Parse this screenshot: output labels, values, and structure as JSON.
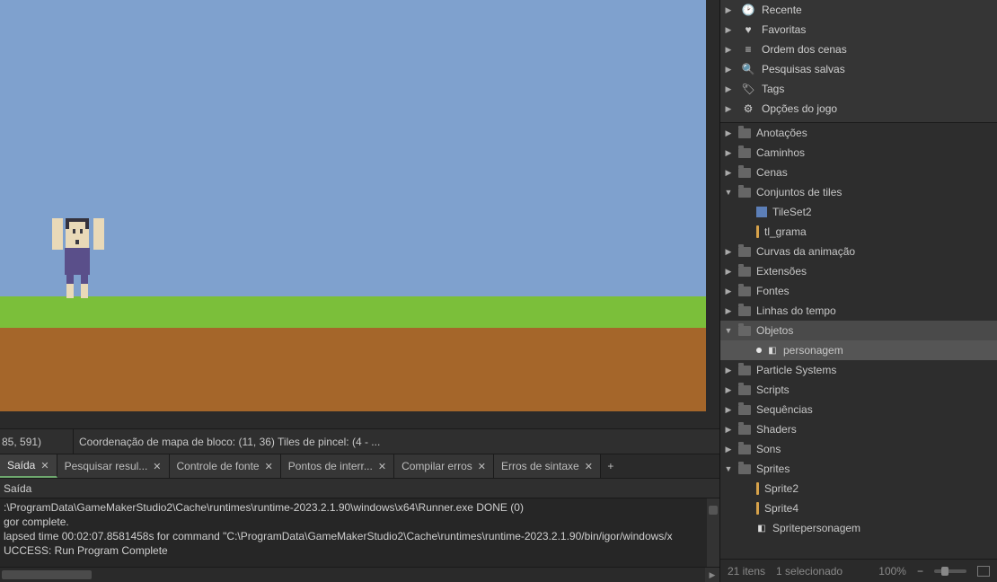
{
  "status": {
    "coords": "85, 591)",
    "info": "Coordenação de mapa de bloco: (11, 36) Tiles de pincel: (4 - ..."
  },
  "output_tabs": [
    {
      "label": "Saída",
      "active": true
    },
    {
      "label": "Pesquisar resul...",
      "active": false
    },
    {
      "label": "Controle de fonte",
      "active": false
    },
    {
      "label": "Pontos de interr...",
      "active": false
    },
    {
      "label": "Compilar erros",
      "active": false
    },
    {
      "label": "Erros de sintaxe",
      "active": false
    }
  ],
  "output_header": "Saída",
  "output_lines": [
    ":\\ProgramData\\GameMakerStudio2\\Cache\\runtimes\\runtime-2023.2.1.90\\windows\\x64\\Runner.exe DONE (0)",
    "gor complete.",
    "lapsed time 00:02:07.8581458s for command \"C:\\ProgramData\\GameMakerStudio2\\Cache\\runtimes\\runtime-2023.2.1.90/bin/igor/windows/x",
    "UCCESS: Run Program Complete"
  ],
  "quick_access": [
    {
      "icon": "clock",
      "label": "Recente"
    },
    {
      "icon": "heart",
      "label": "Favoritas"
    },
    {
      "icon": "order",
      "label": "Ordem dos cenas"
    },
    {
      "icon": "search",
      "label": "Pesquisas salvas"
    },
    {
      "icon": "tag",
      "label": "Tags"
    },
    {
      "icon": "gear",
      "label": "Opções do jogo"
    }
  ],
  "assets": {
    "folders": [
      {
        "name": "Anotações",
        "open": false
      },
      {
        "name": "Caminhos",
        "open": false
      },
      {
        "name": "Cenas",
        "open": false
      },
      {
        "name": "Conjuntos de tiles",
        "open": true,
        "children": [
          {
            "name": "TileSet2",
            "kind": "tileset"
          },
          {
            "name": "tl_grama",
            "kind": "tl"
          }
        ]
      },
      {
        "name": "Curvas da animação",
        "open": false
      },
      {
        "name": "Extensões",
        "open": false
      },
      {
        "name": "Fontes",
        "open": false
      },
      {
        "name": "Linhas do tempo",
        "open": false
      },
      {
        "name": "Objetos",
        "open": true,
        "selectedFolder": true,
        "children": [
          {
            "name": "personagem",
            "kind": "object",
            "selected": true
          }
        ]
      },
      {
        "name": "Particle Systems",
        "open": false
      },
      {
        "name": "Scripts",
        "open": false
      },
      {
        "name": "Sequências",
        "open": false
      },
      {
        "name": "Shaders",
        "open": false
      },
      {
        "name": "Sons",
        "open": false
      },
      {
        "name": "Sprites",
        "open": true,
        "children": [
          {
            "name": "Sprite2",
            "kind": "sprite-tl"
          },
          {
            "name": "Sprite4",
            "kind": "sprite-tl"
          },
          {
            "name": "Spritepersonagem",
            "kind": "sprite-obj"
          }
        ]
      }
    ]
  },
  "footer": {
    "count": "21 itens",
    "selected": "1 selecionado",
    "zoom": "100%"
  }
}
